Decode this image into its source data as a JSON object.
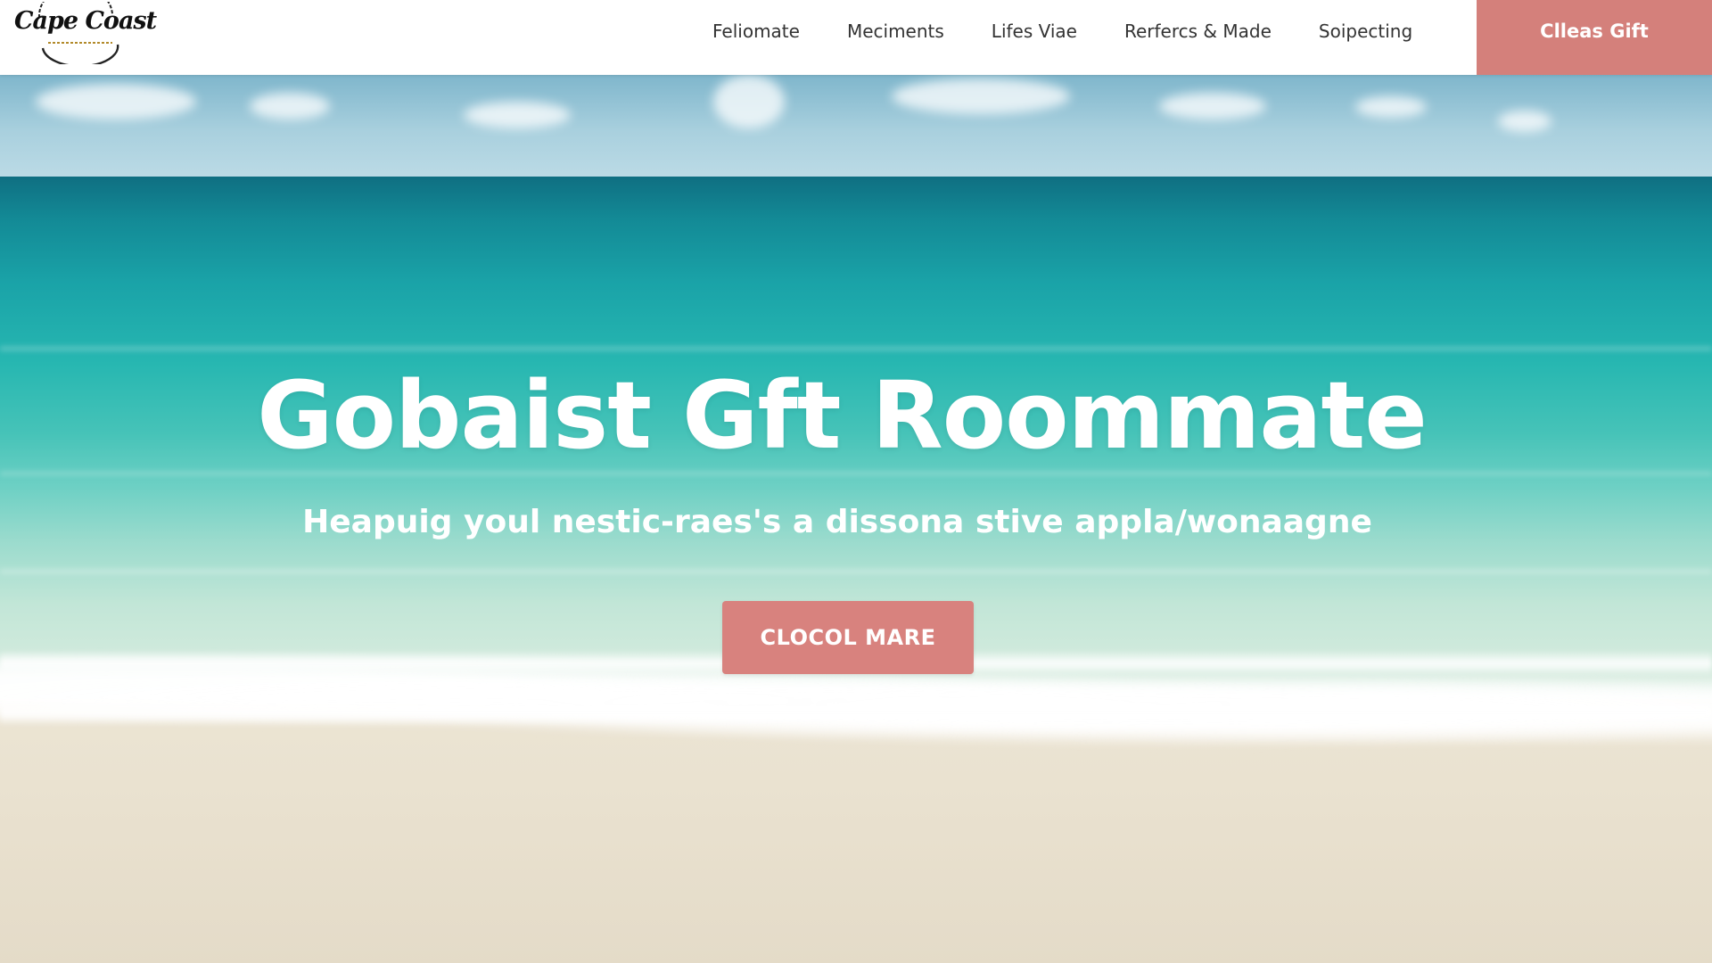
{
  "header": {
    "logo_text": "Cape Coast",
    "nav": [
      {
        "label": "Feliomate"
      },
      {
        "label": "Meciments"
      },
      {
        "label": "Lifes Viae"
      },
      {
        "label": "Rerfercs & Made"
      },
      {
        "label": "Soipecting"
      }
    ],
    "cta_label": "Clleas Gift"
  },
  "hero": {
    "title": "Gobaist Gft Roommate",
    "subtitle": "Heapuig youl nestic-raes's a dissona stive appla/wonaagne",
    "button_label": "CLOCOL MARE"
  },
  "colors": {
    "accent": "#d4807b",
    "header_bg": "#ffffff",
    "nav_text": "#333333",
    "hero_text": "#ffffff"
  }
}
